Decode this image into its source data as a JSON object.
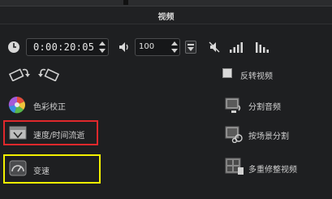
{
  "panel": {
    "title": "视频"
  },
  "controls": {
    "timecode": "0:00:20:05",
    "volume": "100"
  },
  "actions": {
    "color_correct": "色彩校正",
    "speed_time_lapse": "速度/时间流逝",
    "variable_speed": "变速"
  },
  "options": {
    "reverse_video": "反转视频",
    "split_audio": "分割音频",
    "split_by_scene": "按场景分割",
    "multi_trim": "多重修整视频"
  },
  "highlights": {
    "red": "#e0282c",
    "yellow": "#f2f000"
  }
}
